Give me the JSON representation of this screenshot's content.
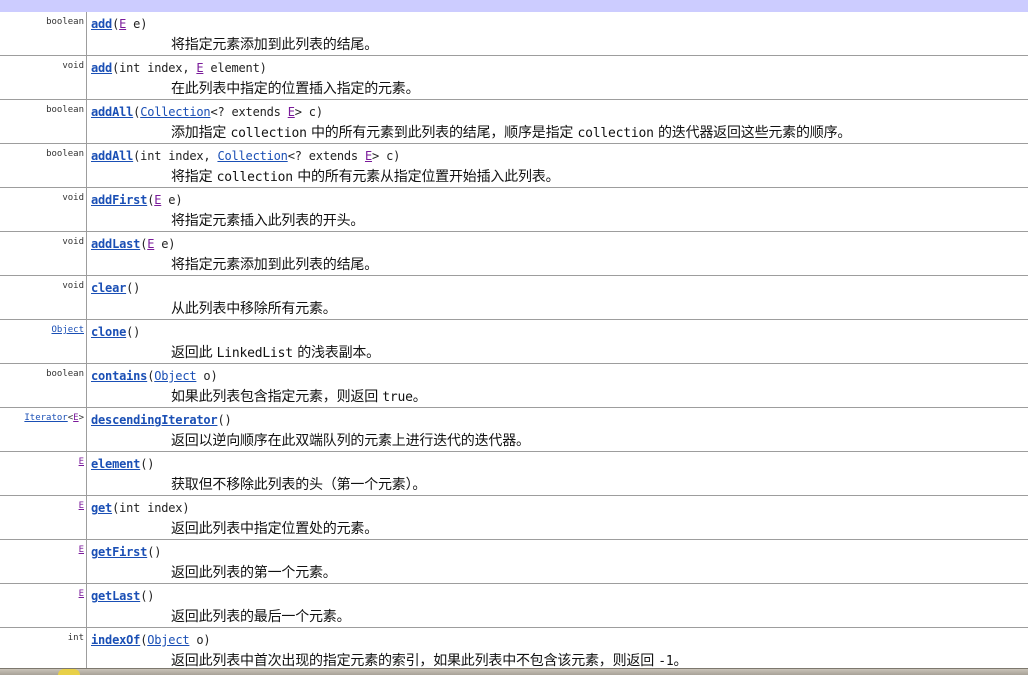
{
  "methods": [
    {
      "type": [
        {
          "t": "boolean",
          "k": "plain"
        }
      ],
      "sig": [
        {
          "t": "add",
          "k": "name"
        },
        {
          "t": "(",
          "k": "plain"
        },
        {
          "t": "E",
          "k": "tvar"
        },
        {
          "t": " e)",
          "k": "plain"
        }
      ],
      "desc": [
        {
          "t": "将指定元素添加到此列表的结尾。",
          "k": "cn"
        }
      ]
    },
    {
      "type": [
        {
          "t": "void",
          "k": "plain"
        }
      ],
      "sig": [
        {
          "t": "add",
          "k": "name"
        },
        {
          "t": "(int index, ",
          "k": "plain"
        },
        {
          "t": "E",
          "k": "tvar"
        },
        {
          "t": " element)",
          "k": "plain"
        }
      ],
      "desc": [
        {
          "t": "在此列表中指定的位置插入指定的元素。",
          "k": "cn"
        }
      ]
    },
    {
      "type": [
        {
          "t": "boolean",
          "k": "plain"
        }
      ],
      "sig": [
        {
          "t": "addAll",
          "k": "name"
        },
        {
          "t": "(",
          "k": "plain"
        },
        {
          "t": "Collection",
          "k": "link"
        },
        {
          "t": "<? extends ",
          "k": "plain"
        },
        {
          "t": "E",
          "k": "tvar"
        },
        {
          "t": "> c)",
          "k": "plain"
        }
      ],
      "desc": [
        {
          "t": "添加指定 ",
          "k": "cn"
        },
        {
          "t": "collection",
          "k": "code"
        },
        {
          "t": " 中的所有元素到此列表的结尾，顺序是指定 ",
          "k": "cn"
        },
        {
          "t": "collection",
          "k": "code"
        },
        {
          "t": " 的迭代器返回这些元素的顺序。",
          "k": "cn"
        }
      ]
    },
    {
      "type": [
        {
          "t": "boolean",
          "k": "plain"
        }
      ],
      "sig": [
        {
          "t": "addAll",
          "k": "name"
        },
        {
          "t": "(int index, ",
          "k": "plain"
        },
        {
          "t": "Collection",
          "k": "link"
        },
        {
          "t": "<? extends ",
          "k": "plain"
        },
        {
          "t": "E",
          "k": "tvar"
        },
        {
          "t": "> c)",
          "k": "plain"
        }
      ],
      "desc": [
        {
          "t": "将指定 ",
          "k": "cn"
        },
        {
          "t": "collection",
          "k": "code"
        },
        {
          "t": " 中的所有元素从指定位置开始插入此列表。",
          "k": "cn"
        }
      ]
    },
    {
      "type": [
        {
          "t": "void",
          "k": "plain"
        }
      ],
      "sig": [
        {
          "t": "addFirst",
          "k": "name"
        },
        {
          "t": "(",
          "k": "plain"
        },
        {
          "t": "E",
          "k": "tvar"
        },
        {
          "t": " e)",
          "k": "plain"
        }
      ],
      "desc": [
        {
          "t": "将指定元素插入此列表的开头。",
          "k": "cn"
        }
      ]
    },
    {
      "type": [
        {
          "t": "void",
          "k": "plain"
        }
      ],
      "sig": [
        {
          "t": "addLast",
          "k": "name"
        },
        {
          "t": "(",
          "k": "plain"
        },
        {
          "t": "E",
          "k": "tvar"
        },
        {
          "t": " e)",
          "k": "plain"
        }
      ],
      "desc": [
        {
          "t": "将指定元素添加到此列表的结尾。",
          "k": "cn"
        }
      ]
    },
    {
      "type": [
        {
          "t": "void",
          "k": "plain"
        }
      ],
      "sig": [
        {
          "t": "clear",
          "k": "name"
        },
        {
          "t": "()",
          "k": "plain"
        }
      ],
      "desc": [
        {
          "t": "从此列表中移除所有元素。",
          "k": "cn"
        }
      ]
    },
    {
      "type": [
        {
          "t": "Object",
          "k": "link"
        }
      ],
      "sig": [
        {
          "t": "clone",
          "k": "name"
        },
        {
          "t": "()",
          "k": "plain"
        }
      ],
      "desc": [
        {
          "t": "返回此 ",
          "k": "cn"
        },
        {
          "t": "LinkedList",
          "k": "code"
        },
        {
          "t": " 的浅表副本。",
          "k": "cn"
        }
      ]
    },
    {
      "type": [
        {
          "t": "boolean",
          "k": "plain"
        }
      ],
      "sig": [
        {
          "t": "contains",
          "k": "name"
        },
        {
          "t": "(",
          "k": "plain"
        },
        {
          "t": "Object",
          "k": "link"
        },
        {
          "t": " o)",
          "k": "plain"
        }
      ],
      "desc": [
        {
          "t": "如果此列表包含指定元素，则返回 ",
          "k": "cn"
        },
        {
          "t": "true",
          "k": "code"
        },
        {
          "t": "。",
          "k": "cn"
        }
      ]
    },
    {
      "type": [
        {
          "t": "Iterator",
          "k": "link"
        },
        {
          "t": "<",
          "k": "plain"
        },
        {
          "t": "E",
          "k": "tvar"
        },
        {
          "t": ">",
          "k": "plain"
        }
      ],
      "sig": [
        {
          "t": "descendingIterator",
          "k": "name"
        },
        {
          "t": "()",
          "k": "plain"
        }
      ],
      "desc": [
        {
          "t": "返回以逆向顺序在此双端队列的元素上进行迭代的迭代器。",
          "k": "cn"
        }
      ]
    },
    {
      "type": [
        {
          "t": "E",
          "k": "tvar"
        }
      ],
      "sig": [
        {
          "t": "element",
          "k": "name"
        },
        {
          "t": "()",
          "k": "plain"
        }
      ],
      "desc": [
        {
          "t": "获取但不移除此列表的头（第一个元素）。",
          "k": "cn"
        }
      ]
    },
    {
      "type": [
        {
          "t": "E",
          "k": "tvar"
        }
      ],
      "sig": [
        {
          "t": "get",
          "k": "name"
        },
        {
          "t": "(int index)",
          "k": "plain"
        }
      ],
      "desc": [
        {
          "t": "返回此列表中指定位置处的元素。",
          "k": "cn"
        }
      ]
    },
    {
      "type": [
        {
          "t": "E",
          "k": "tvar"
        }
      ],
      "sig": [
        {
          "t": "getFirst",
          "k": "name"
        },
        {
          "t": "()",
          "k": "plain"
        }
      ],
      "desc": [
        {
          "t": "返回此列表的第一个元素。",
          "k": "cn"
        }
      ]
    },
    {
      "type": [
        {
          "t": "E",
          "k": "tvar"
        }
      ],
      "sig": [
        {
          "t": "getLast",
          "k": "name"
        },
        {
          "t": "()",
          "k": "plain"
        }
      ],
      "desc": [
        {
          "t": "返回此列表的最后一个元素。",
          "k": "cn"
        }
      ]
    },
    {
      "type": [
        {
          "t": "int",
          "k": "plain"
        }
      ],
      "sig": [
        {
          "t": "indexOf",
          "k": "name"
        },
        {
          "t": "(",
          "k": "plain"
        },
        {
          "t": "Object",
          "k": "link"
        },
        {
          "t": " o)",
          "k": "plain"
        }
      ],
      "desc": [
        {
          "t": "返回此列表中首次出现的指定元素的索引，如果此列表中不包含该元素，则返回 ",
          "k": "cn"
        },
        {
          "t": "-1",
          "k": "code"
        },
        {
          "t": "。",
          "k": "cn"
        }
      ]
    }
  ]
}
